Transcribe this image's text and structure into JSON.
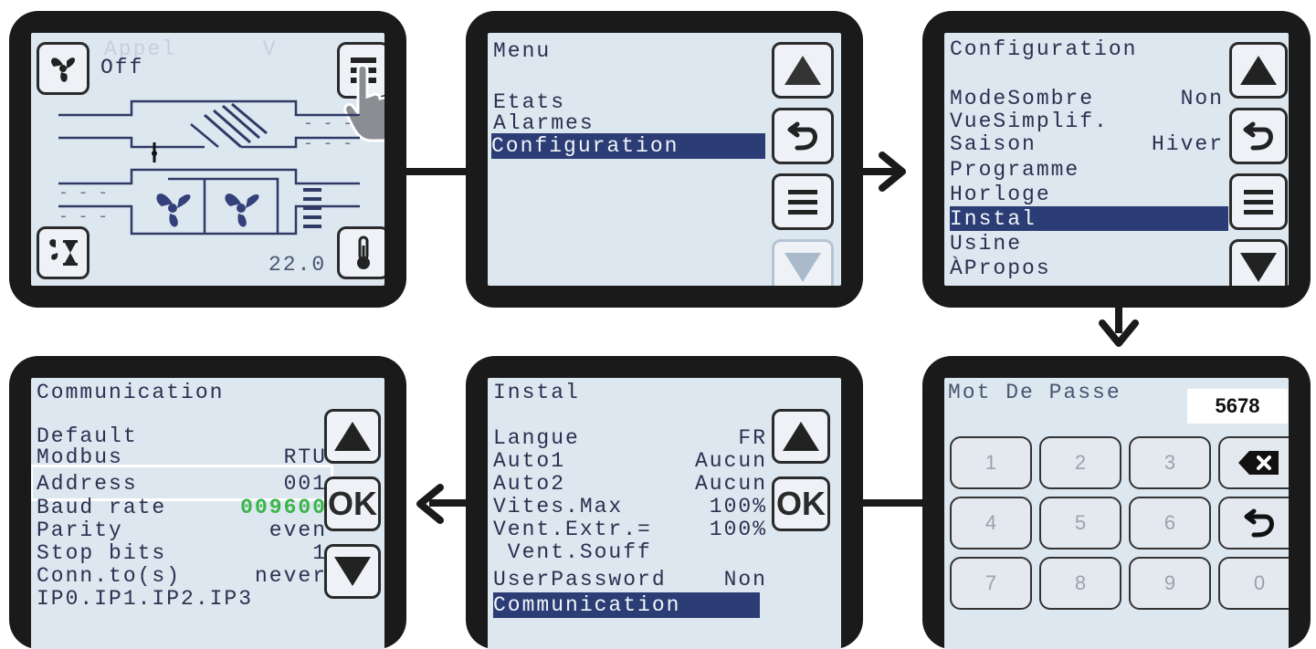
{
  "panel1": {
    "title": "Appel      V",
    "fan_state": "Off",
    "temperature": "22.0",
    "icons": [
      "fan-icon",
      "menu-icon",
      "hand-pointer-icon",
      "fan-timer-icon",
      "thermometer-icon"
    ]
  },
  "panel2": {
    "title": "Menu",
    "items": [
      "Etats",
      "Alarmes",
      "Configuration"
    ],
    "selected": "Configuration"
  },
  "panel3": {
    "title": "Configuration",
    "items": [
      {
        "label": "ModeSombre",
        "value": "Non"
      },
      {
        "label": "VueSimplif.",
        "value": ""
      },
      {
        "label": "Saison",
        "value": "Hiver"
      },
      {
        "label": "Programme",
        "value": ""
      },
      {
        "label": "Horloge",
        "value": ""
      },
      {
        "label": "Instal",
        "value": ""
      },
      {
        "label": "Usine",
        "value": ""
      },
      {
        "label": "ÀPropos",
        "value": ""
      }
    ],
    "selected": "Instal"
  },
  "panel4": {
    "title": "Mot De Passe",
    "password": "5678",
    "keys": [
      "1",
      "2",
      "3",
      "4",
      "5",
      "6",
      "7",
      "8",
      "9",
      "0"
    ]
  },
  "panel5": {
    "title": "Instal",
    "items": [
      {
        "label": "Langue",
        "value": "FR"
      },
      {
        "label": "Auto1",
        "value": "Aucun"
      },
      {
        "label": "Auto2",
        "value": "Aucun"
      },
      {
        "label": "Vites.Max",
        "value": "100%"
      },
      {
        "label": "Vent.Extr.=",
        "value": "100%"
      },
      {
        "label": " Vent.Souff",
        "value": ""
      },
      {
        "label": "UserPassword",
        "value": "Non"
      },
      {
        "label": "Communication",
        "value": ""
      }
    ],
    "ok_label": "OK"
  },
  "panel6": {
    "title": "Communication",
    "items": [
      {
        "label": "Default",
        "value": ""
      },
      {
        "label": "Modbus",
        "value": "RTU"
      },
      {
        "label": "Address",
        "value": "001"
      },
      {
        "label": "Baud rate",
        "value": "009600"
      },
      {
        "label": "Parity",
        "value": "even"
      },
      {
        "label": "Stop bits",
        "value": "1"
      },
      {
        "label": "Conn.to(s)",
        "value": "never"
      },
      {
        "label": "IP0.IP1.IP2.IP3",
        "value": ""
      }
    ],
    "ok_label": "OK"
  },
  "colors": {
    "accent": "#2b3d74",
    "baud_value": "#3ab54a",
    "lcd_text": "#2a3150",
    "bezel": "#1a1a1a",
    "screen": "#dde7f0"
  }
}
